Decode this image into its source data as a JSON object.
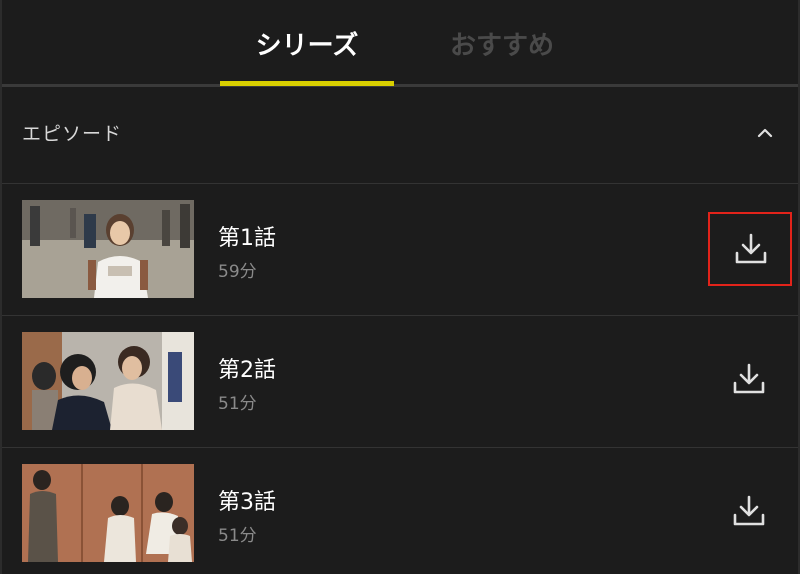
{
  "tabs": {
    "series_label": "シリーズ",
    "recommend_label": "おすすめ",
    "active": "series",
    "indicator_color": "#d9cf00"
  },
  "section": {
    "title": "エピソード",
    "collapse_icon": "chevron-up-icon"
  },
  "episodes": [
    {
      "title": "第1話",
      "duration": "59分",
      "download_icon": "download-icon",
      "highlighted": true
    },
    {
      "title": "第2話",
      "duration": "51分",
      "download_icon": "download-icon",
      "highlighted": false
    },
    {
      "title": "第3話",
      "duration": "51分",
      "download_icon": "download-icon",
      "highlighted": false
    }
  ],
  "colors": {
    "background": "#1c1c1c",
    "highlight_border": "#e2231a",
    "secondary_text": "#8a8a8a"
  }
}
